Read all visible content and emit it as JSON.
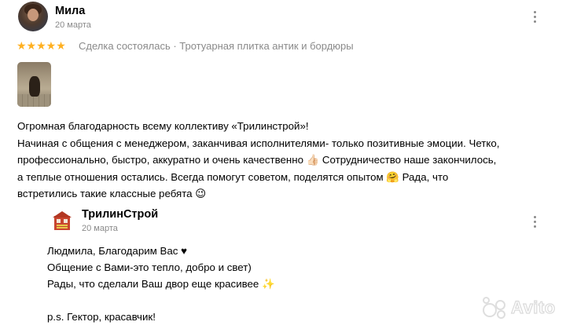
{
  "review": {
    "author": "Мила",
    "date": "20 марта",
    "stars": "★★★★★",
    "star_color": "#ffb021",
    "deal_status": "Сделка состоялась · Тротуарная плитка антик и бордюры",
    "text_lines": [
      "Огромная благодарность всему коллективу «Трилинстрой»!",
      "Начиная с общения с менеджером, заканчивая исполнителями- только позитивные эмоции. Четко,",
      "профессионально, быстро, аккуратно и очень качественно 👍🏻 Сотрудничество наше закончилось,",
      "а теплые отношения остались. Всегда помогут советом, поделятся опытом 🤗 Рада, что",
      "встретились такие классные ребята 😉"
    ]
  },
  "reply": {
    "author": "ТрилинСтрой",
    "date": "20 марта",
    "lines": [
      "Людмила, Благодарим Вас ♥",
      "Общение с Вами-это тепло, добро и свет)",
      "Рады, что сделали Ваш двор еще красивее ✨",
      "",
      "p.s. Гектор, красавчик!"
    ]
  },
  "watermark": "Avito"
}
